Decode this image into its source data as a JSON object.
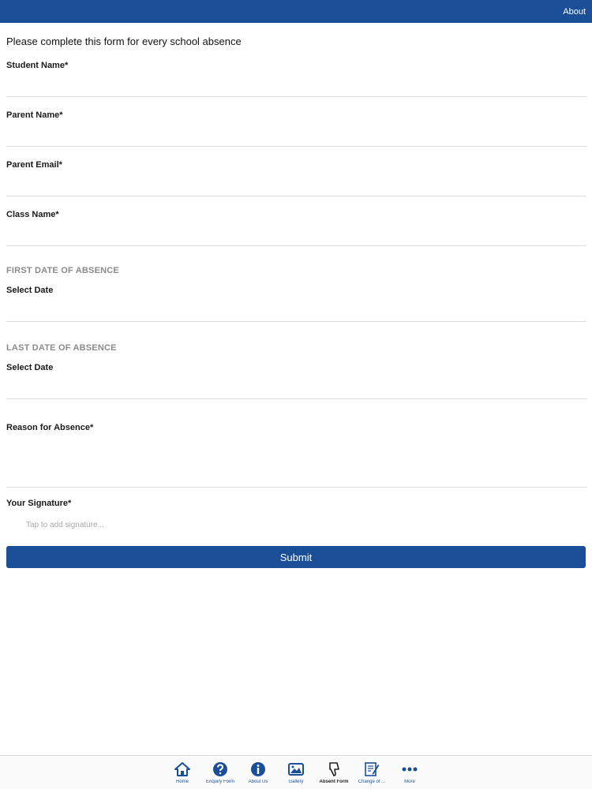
{
  "header": {
    "about_label": "About",
    "bar_color": "#1a4f97"
  },
  "form": {
    "intro": "Please complete this form for every school absence",
    "student_name_label": "Student Name*",
    "parent_name_label": "Parent Name*",
    "parent_email_label": "Parent Email*",
    "class_name_label": "Class Name*",
    "first_date_section": "FIRST DATE OF ABSENCE",
    "first_date_label": "Select Date",
    "last_date_section": "LAST DATE OF ABSENCE",
    "last_date_label": "Select Date",
    "reason_label": "Reason for Absence*",
    "signature_label": "Your Signature*",
    "signature_hint": "Tap to add signature...",
    "submit_label": "Submit"
  },
  "tabs": [
    {
      "label": "Home",
      "icon": "home-icon"
    },
    {
      "label": "Enquiry Form",
      "icon": "question-icon"
    },
    {
      "label": "About Us",
      "icon": "info-icon"
    },
    {
      "label": "Gallery",
      "icon": "gallery-icon"
    },
    {
      "label": "Absent Form",
      "icon": "thumbs-down-icon",
      "active": true
    },
    {
      "label": "Change of ...",
      "icon": "edit-icon"
    },
    {
      "label": "More",
      "icon": "more-icon"
    }
  ]
}
